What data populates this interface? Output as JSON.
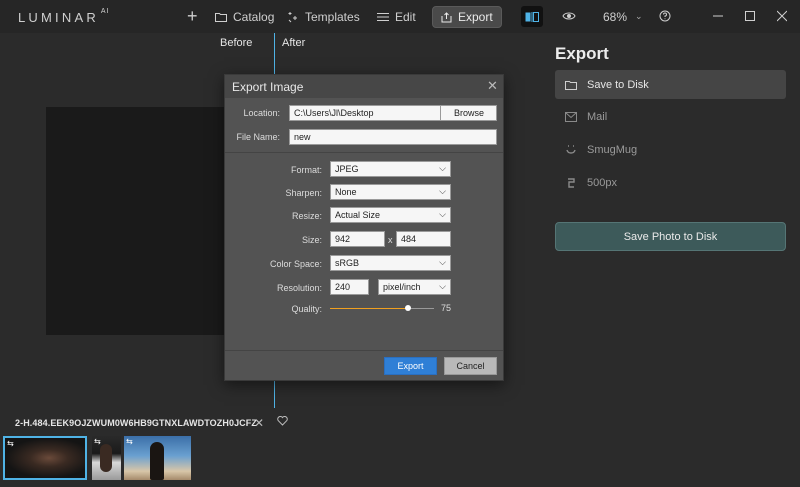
{
  "app": {
    "logo": "LUMINAR",
    "logo_sup": "AI"
  },
  "nav": {
    "catalog": "Catalog",
    "templates": "Templates",
    "edit": "Edit",
    "export": "Export",
    "zoom": "68%"
  },
  "compare": {
    "before": "Before",
    "after": "After"
  },
  "panel": {
    "title": "Export",
    "items": [
      {
        "label": "Save to Disk",
        "icon": "folder-icon",
        "active": true
      },
      {
        "label": "Mail",
        "icon": "mail-icon",
        "active": false
      },
      {
        "label": "SmugMug",
        "icon": "smugmug-icon",
        "active": false
      },
      {
        "label": "500px",
        "icon": "500px-icon",
        "active": false
      }
    ],
    "save_button": "Save Photo to Disk"
  },
  "dialog": {
    "title": "Export Image",
    "location_label": "Location:",
    "location_value": "C:\\Users\\Jl\\Desktop",
    "browse": "Browse",
    "filename_label": "File Name:",
    "filename_value": "new",
    "format_label": "Format:",
    "format_value": "JPEG",
    "sharpen_label": "Sharpen:",
    "sharpen_value": "None",
    "resize_label": "Resize:",
    "resize_value": "Actual Size",
    "size_label": "Size:",
    "width": "942",
    "size_sep": "x",
    "height": "484",
    "colorspace_label": "Color Space:",
    "colorspace_value": "sRGB",
    "resolution_label": "Resolution:",
    "resolution_value": "240",
    "resolution_unit": "pixel/inch",
    "quality_label": "Quality:",
    "quality_value": "75",
    "export_button": "Export",
    "cancel_button": "Cancel"
  },
  "filmstrip": {
    "filename": "2-H.484.EEK9OJZWUM0W6HB9GTNXLAWDTOZH0JCFZ"
  },
  "colors": {
    "accent": "#4fb3e6",
    "export_btn": "#2f7fd6",
    "save_btn": "#3d5a5a",
    "slider": "#f0a020"
  }
}
